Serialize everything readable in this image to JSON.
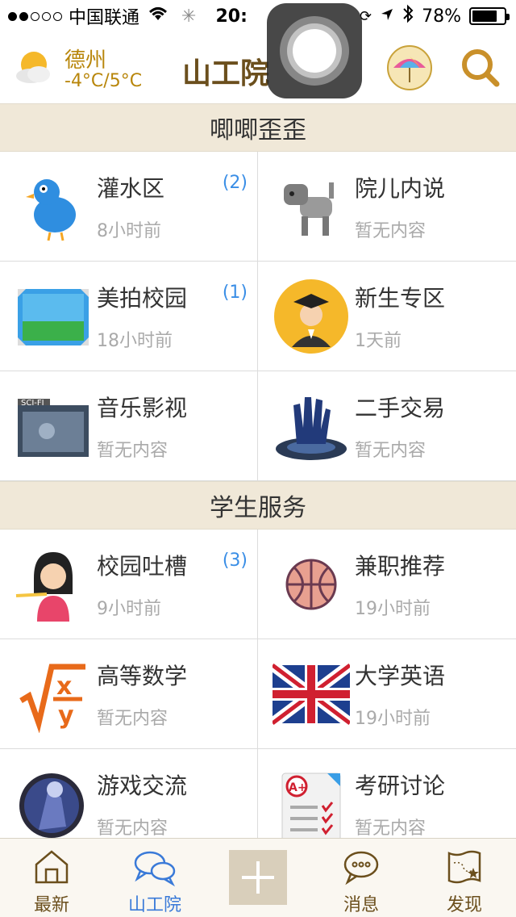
{
  "status_bar": {
    "carrier": "中国联通",
    "time": "20:",
    "battery": "78%",
    "battery_level": 0.78
  },
  "header": {
    "city": "德州",
    "temperature": "-4°C/5°C",
    "title": "山工院"
  },
  "sections": [
    {
      "title": "唧唧歪歪",
      "items": [
        {
          "label": "灌水区",
          "sub": "8小时前",
          "count": "(2)",
          "icon": "bird-icon"
        },
        {
          "label": "院儿内说",
          "sub": "暂无内容",
          "count": "",
          "icon": "robot-dog-icon"
        },
        {
          "label": "美拍校园",
          "sub": "18小时前",
          "count": "(1)",
          "icon": "picture-icon"
        },
        {
          "label": "新生专区",
          "sub": "1天前",
          "count": "",
          "icon": "graduate-icon"
        },
        {
          "label": "音乐影视",
          "sub": "暂无内容",
          "count": "",
          "icon": "movie-folder-icon"
        },
        {
          "label": "二手交易",
          "sub": "暂无内容",
          "count": "",
          "icon": "hand-icon"
        }
      ]
    },
    {
      "title": "学生服务",
      "items": [
        {
          "label": "校园吐槽",
          "sub": "9小时前",
          "count": "(3)",
          "icon": "girl-icon"
        },
        {
          "label": "兼职推荐",
          "sub": "19小时前",
          "count": "",
          "icon": "basketball-icon"
        },
        {
          "label": "高等数学",
          "sub": "暂无内容",
          "count": "",
          "icon": "math-icon"
        },
        {
          "label": "大学英语",
          "sub": "19小时前",
          "count": "",
          "icon": "uk-flag-icon"
        },
        {
          "label": "游戏交流",
          "sub": "暂无内容",
          "count": "",
          "icon": "game-icon"
        },
        {
          "label": "考研讨论",
          "sub": "暂无内容",
          "count": "",
          "icon": "exam-icon"
        }
      ]
    }
  ],
  "tabbar": {
    "items": [
      {
        "label": "最新",
        "icon": "home-icon"
      },
      {
        "label": "山工院",
        "icon": "chat-bubbles-icon"
      },
      {
        "label": "",
        "icon": "plus-icon"
      },
      {
        "label": "消息",
        "icon": "message-icon"
      },
      {
        "label": "发现",
        "icon": "map-icon"
      }
    ]
  },
  "colors": {
    "accent": "#6b4f1d",
    "active": "#3a7ad8",
    "count": "#3a8ee6",
    "section_bg": "#f0e8d8"
  }
}
